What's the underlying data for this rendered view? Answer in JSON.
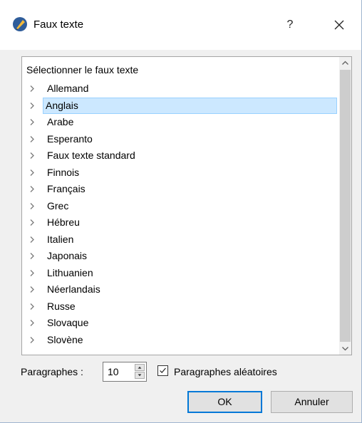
{
  "window": {
    "title": "Faux texte",
    "help_label": "?",
    "icons": {
      "app": "pen-nib-icon",
      "close": "close-icon"
    }
  },
  "tree": {
    "header": "Sélectionner le faux texte",
    "items": [
      {
        "label": "Allemand",
        "selected": false
      },
      {
        "label": "Anglais",
        "selected": true
      },
      {
        "label": "Arabe",
        "selected": false
      },
      {
        "label": "Esperanto",
        "selected": false
      },
      {
        "label": "Faux texte standard",
        "selected": false
      },
      {
        "label": "Finnois",
        "selected": false
      },
      {
        "label": "Français",
        "selected": false
      },
      {
        "label": "Grec",
        "selected": false
      },
      {
        "label": "Hébreu",
        "selected": false
      },
      {
        "label": "Italien",
        "selected": false
      },
      {
        "label": "Japonais",
        "selected": false
      },
      {
        "label": "Lithuanien",
        "selected": false
      },
      {
        "label": "Néerlandais",
        "selected": false
      },
      {
        "label": "Russe",
        "selected": false
      },
      {
        "label": "Slovaque",
        "selected": false
      },
      {
        "label": "Slovène",
        "selected": false
      }
    ]
  },
  "options": {
    "paragraphs_label": "Paragraphes :",
    "paragraphs_value": "10",
    "random_label": "Paragraphes aléatoires",
    "random_checked": true
  },
  "buttons": {
    "ok": "OK",
    "cancel": "Annuler"
  },
  "colors": {
    "selection_bg": "#cce8ff",
    "selection_border": "#99d1ff",
    "default_button_border": "#0078d7"
  }
}
